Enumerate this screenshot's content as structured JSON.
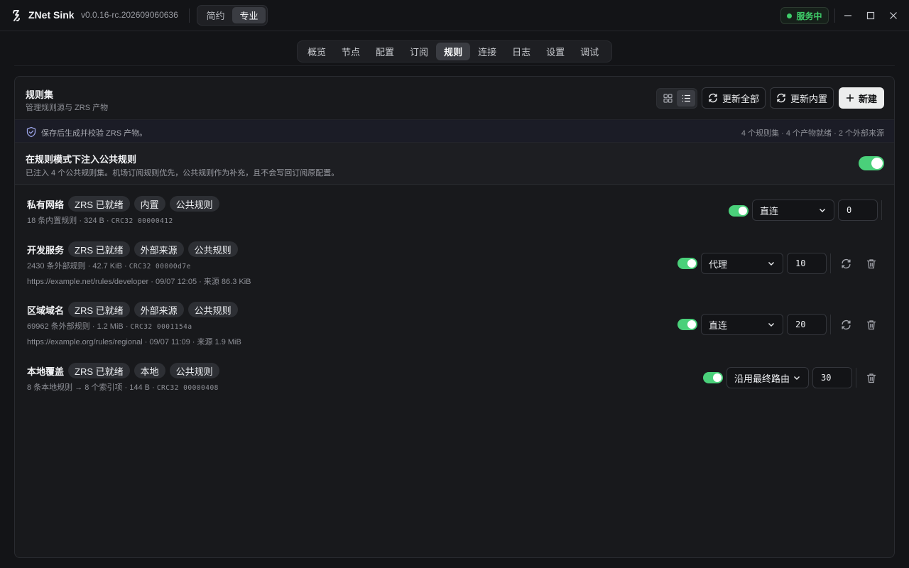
{
  "app": {
    "title": "ZNet Sink",
    "version": "v0.0.16-rc.202609060636",
    "modes": [
      "简约",
      "专业"
    ],
    "active_mode": 1,
    "status": "服务中"
  },
  "nav": {
    "tabs": [
      "概览",
      "节点",
      "配置",
      "订阅",
      "规则",
      "连接",
      "日志",
      "设置",
      "调试"
    ],
    "active": 4
  },
  "ruleset": {
    "title": "规则集",
    "subtitle": "管理规则源与 ZRS 产物",
    "buttons": {
      "update_all": "更新全部",
      "update_builtin": "更新内置",
      "new": "新建"
    },
    "info": {
      "text": "保存后生成并校验 ZRS 产物。",
      "stats": "4 个规则集 · 4 个产物就绪 · 2 个外部来源"
    },
    "inject": {
      "title": "在规则模式下注入公共规则",
      "desc": "已注入 4 个公共规则集。机场订阅规则优先，公共规则作为补充，且不会写回订阅原配置。",
      "enabled": true
    },
    "rules": [
      {
        "name": "私有网络",
        "tags": [
          "ZRS 已就绪",
          "内置",
          "公共规则"
        ],
        "count": "18 条内置规则",
        "size": "324 B",
        "crc": "CRC32 00000412",
        "source": "",
        "enabled": true,
        "policy": "直连",
        "priority": "0"
      },
      {
        "name": "开发服务",
        "tags": [
          "ZRS 已就绪",
          "外部来源",
          "公共规则"
        ],
        "count": "2430 条外部规则",
        "size": "42.7 KiB",
        "crc": "CRC32 00000d7e",
        "source": "https://example.net/rules/developer · 09/07 12:05 · 来源 86.3 KiB",
        "enabled": true,
        "policy": "代理",
        "priority": "10"
      },
      {
        "name": "区域域名",
        "tags": [
          "ZRS 已就绪",
          "外部来源",
          "公共规则"
        ],
        "count": "69962 条外部规则",
        "size": "1.2 MiB",
        "crc": "CRC32 0001154a",
        "source": "https://example.org/rules/regional · 09/07 11:09 · 来源 1.9 MiB",
        "enabled": true,
        "policy": "直连",
        "priority": "20"
      },
      {
        "name": "本地覆盖",
        "tags": [
          "ZRS 已就绪",
          "本地",
          "公共规则"
        ],
        "count": "8 条本地规则 → 8 个索引项",
        "size": "144 B",
        "crc": "CRC32 00000408",
        "source": "",
        "enabled": true,
        "policy": "沿用最终路由",
        "priority": "30"
      }
    ]
  },
  "colors": {
    "background": "#131417",
    "card": "#18191c",
    "accent_green": "#4ad07a",
    "status_green": "#3fcf6a"
  }
}
